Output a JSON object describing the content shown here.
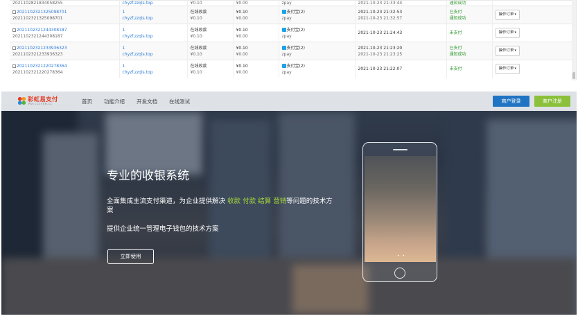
{
  "orders": {
    "rows": [
      {
        "trade_no": "",
        "trade_no_sub": "2021102821834058255",
        "shop_id": "",
        "shop_domain": "chyzf.zzqls.top",
        "name": "",
        "name_money": "¥0.10",
        "money": "",
        "money_actual": "¥0.00",
        "pay_type": "",
        "pay_channel": "zpay",
        "time_created": "",
        "time_paid": "2021-10-23 21:33:44",
        "status": "",
        "status_sub": "通知成功",
        "action": ""
      },
      {
        "trade_no": "2021102321325098701",
        "trade_no_sub": "2021102321325098701",
        "shop_id": "1",
        "shop_domain": "chyzf.zzqls.top",
        "name": "在线收款",
        "name_money": "¥0.10",
        "money": "¥0.10",
        "money_actual": "¥0.00",
        "pay_type": "支付宝(2)",
        "pay_channel": "zpay",
        "time_created": "2021-10-23 21:32:53",
        "time_paid": "2021-10-23 21:32:57",
        "status": "已支付",
        "status_sub": "通知成功",
        "action": "操作订单"
      },
      {
        "trade_no": "2021102321244308187",
        "trade_no_sub": "2021102321244308187",
        "shop_id": "1",
        "shop_domain": "chyzf.zzqls.top",
        "name": "在线收款",
        "name_money": "¥0.10",
        "money": "¥0.10",
        "money_actual": "¥0.00",
        "pay_type": "支付宝(2)",
        "pay_channel": "zpay",
        "time_created": "2021-10-23 21:24:43",
        "time_paid": "",
        "status": "未支付",
        "status_sub": "",
        "action": "操作订单"
      },
      {
        "trade_no": "2021102321233936323",
        "trade_no_sub": "2021102321233936323",
        "shop_id": "1",
        "shop_domain": "chyzf.zzqls.top",
        "name": "在线收款",
        "name_money": "¥0.10",
        "money": "¥0.10",
        "money_actual": "¥0.00",
        "pay_type": "支付宝(2)",
        "pay_channel": "zpay",
        "time_created": "2021-10-23 21:23:20",
        "time_paid": "2021-10-23 21:23:25",
        "status": "已支付",
        "status_sub": "通知成功",
        "action": "操作订单"
      },
      {
        "trade_no": "2021102321220278364",
        "trade_no_sub": "2021102321220278364",
        "shop_id": "1",
        "shop_domain": "chyzf.zzqls.top",
        "name": "在线收款",
        "name_money": "¥0.10",
        "money": "¥0.10",
        "money_actual": "¥0.00",
        "pay_type": "支付宝(2)",
        "pay_channel": "zpay",
        "time_created": "2021-10-23 21:22:07",
        "time_paid": "",
        "status": "未支付",
        "status_sub": "",
        "action": "操作订单"
      }
    ]
  },
  "landing": {
    "logo_text": "彩虹易支付",
    "logo_sub": "PAY.CCCYUN.CC",
    "nav": [
      "首页",
      "功能介绍",
      "开发文档",
      "在线测试"
    ],
    "login_label": "商户登录",
    "register_label": "商户注册",
    "hero_title": "专业的收银系统",
    "hero_line1_prefix": "全面集成主流支付渠道，为企业提供解决",
    "hero_highlights": [
      "收款",
      "付款",
      "结算",
      "营销"
    ],
    "hero_line1_suffix": "等问题的技术方案",
    "hero_line2": "提供企业统一管理电子钱包的技术方案",
    "cta_label": "立即使用",
    "phone_dots": "• •"
  },
  "colors": {
    "link": "#2b7bd6",
    "success_green": "#2f9a2f",
    "login_blue": "#1f74c3",
    "register_green": "#8ac03a",
    "highlight_green": "#a6d63a",
    "logo_red": "#e23c25"
  },
  "icons": {
    "pay_type": "alipay-icon",
    "logo": "rainbow-logo-icon",
    "checkbox": "checkbox-icon",
    "dropdown": "caret-down-icon"
  }
}
